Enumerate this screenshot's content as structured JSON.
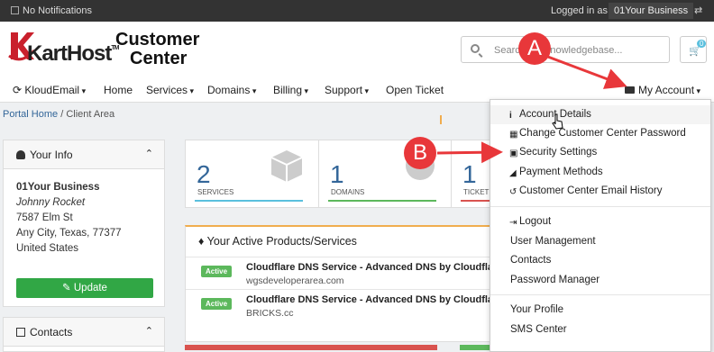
{
  "topbar": {
    "notifications": "No Notifications",
    "logged_in_label": "Logged in as:",
    "business": "01Your Business"
  },
  "header": {
    "logo_text": "KartHost",
    "logo_tm": "TM",
    "title_line1": "Customer",
    "title_line2": "Center",
    "search_placeholder": "Search our knowledgebase...",
    "cart_count": "0"
  },
  "nav": {
    "items": [
      "KloudEmail",
      "Home",
      "Services",
      "Domains",
      "Billing",
      "Support",
      "Open Ticket"
    ],
    "account": "My Account"
  },
  "breadcrumb": {
    "home": "Portal Home",
    "sep": "/",
    "current": "Client Area"
  },
  "your_info": {
    "title": "Your Info",
    "company": "01Your Business",
    "name": "Johnny Rocket",
    "address1": "7587 Elm St",
    "address2": "Any City, Texas, 77377",
    "country": "United States",
    "update_label": "Update"
  },
  "contacts": {
    "title": "Contacts"
  },
  "stats": [
    {
      "count": "2",
      "label": "SERVICES",
      "color": "#5bc0de"
    },
    {
      "count": "1",
      "label": "DOMAINS",
      "color": "#5cb85c"
    },
    {
      "count": "1",
      "label": "TICKETS",
      "color": "#d9534f"
    }
  ],
  "products": {
    "title": "Your Active Products/Services",
    "rows": [
      {
        "status": "Active",
        "name": "Cloudflare DNS Service - Advanced DNS by Cloudflare -",
        "domain": "wgsdeveloperarea.com"
      },
      {
        "status": "Active",
        "name": "Cloudflare DNS Service - Advanced DNS by Cloudflare -",
        "domain": "BRICKS.cc"
      }
    ]
  },
  "account_menu": {
    "items": [
      "Account Details",
      "Change Customer Center Password",
      "Security Settings",
      "Payment Methods",
      "Customer Center Email History",
      "Logout",
      "User Management",
      "Contacts",
      "Password Manager",
      "Your Profile",
      "SMS Center"
    ]
  },
  "annotations": {
    "a": "A",
    "b": "B"
  },
  "colors": {
    "accent": "#336699",
    "annotation": "#e8373a",
    "success": "#31a745"
  }
}
